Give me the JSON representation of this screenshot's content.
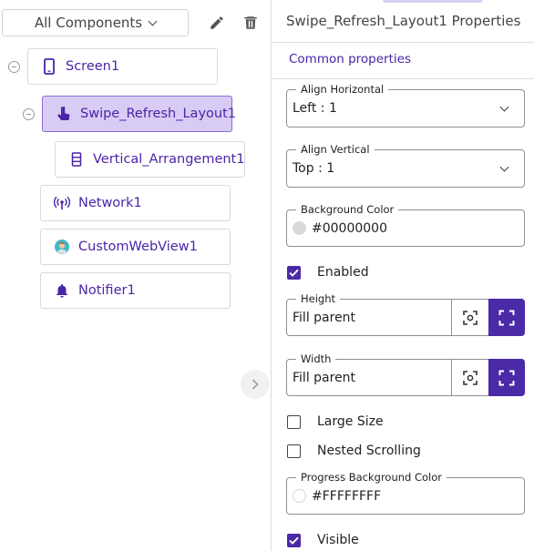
{
  "filter": {
    "label": "All Components"
  },
  "tree": {
    "screen": "Screen1",
    "swipe": "Swipe_Refresh_Layout1",
    "vertical": "Vertical_Arrangement1",
    "network": "Network1",
    "webview": "CustomWebView1",
    "notifier": "Notifier1"
  },
  "properties": {
    "title": "Swipe_Refresh_Layout1 Properties",
    "section": "Common properties",
    "align_horizontal": {
      "label": "Align Horizontal",
      "value": "Left : 1"
    },
    "align_vertical": {
      "label": "Align Vertical",
      "value": "Top : 1"
    },
    "background_color": {
      "label": "Background Color",
      "value": "#00000000",
      "swatch": "#d9d9d9"
    },
    "enabled": {
      "label": "Enabled",
      "checked": true
    },
    "height": {
      "label": "Height",
      "value": "Fill parent"
    },
    "width": {
      "label": "Width",
      "value": "Fill parent"
    },
    "large_size": {
      "label": "Large Size",
      "checked": false
    },
    "nested_scrolling": {
      "label": "Nested Scrolling",
      "checked": false
    },
    "progress_bg_color": {
      "label": "Progress Background Color",
      "value": "#FFFFFFFF",
      "swatch": "#ffffff"
    },
    "visible": {
      "label": "Visible",
      "checked": true
    }
  },
  "colors": {
    "accent": "#4a2aa6",
    "link": "#4a24a8",
    "selected_bg": "#d8ccf5"
  }
}
